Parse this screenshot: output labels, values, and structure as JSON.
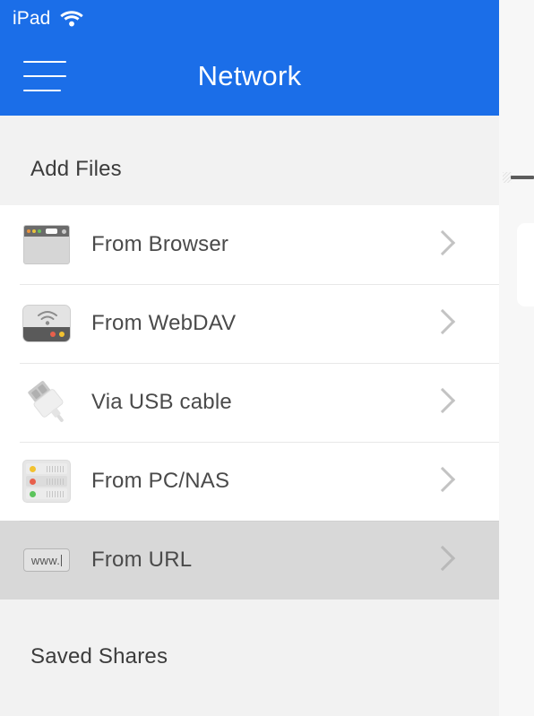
{
  "status_bar": {
    "device_label": "iPad",
    "wifi_icon": "wifi-icon",
    "background_color": "#1b6ee8"
  },
  "nav_bar": {
    "menu_icon": "hamburger-menu-icon",
    "title": "Network",
    "background_color": "#1b6ee8",
    "title_color": "#ffffff"
  },
  "sections": [
    {
      "header": "Add Files",
      "items": [
        {
          "label": "From Browser",
          "icon": "browser-window-icon",
          "accessory": "chevron-right-icon",
          "pressed": false
        },
        {
          "label": "From WebDAV",
          "icon": "wifi-drive-icon",
          "accessory": "chevron-right-icon",
          "pressed": false
        },
        {
          "label": "Via USB cable",
          "icon": "usb-connector-icon",
          "accessory": "chevron-right-icon",
          "pressed": false
        },
        {
          "label": "From PC/NAS",
          "icon": "nas-server-icon",
          "accessory": "chevron-right-icon",
          "pressed": false
        },
        {
          "label": "From URL",
          "icon": "url-field-icon",
          "icon_text": "www.",
          "accessory": "chevron-right-icon",
          "pressed": true
        }
      ]
    },
    {
      "header": "Saved Shares",
      "items": []
    }
  ],
  "colors": {
    "accent": "#1b6ee8",
    "page_background": "#f2f2f2",
    "row_background": "#ffffff",
    "row_pressed_background": "#d8d8d8",
    "separator": "#e8e8e8",
    "primary_text": "#4a4a4a",
    "header_text": "#3c3c3c",
    "chevron": "#c3c3c3",
    "led_red": "#e8604c",
    "led_yellow": "#f2c230",
    "led_green": "#5cc45c"
  }
}
